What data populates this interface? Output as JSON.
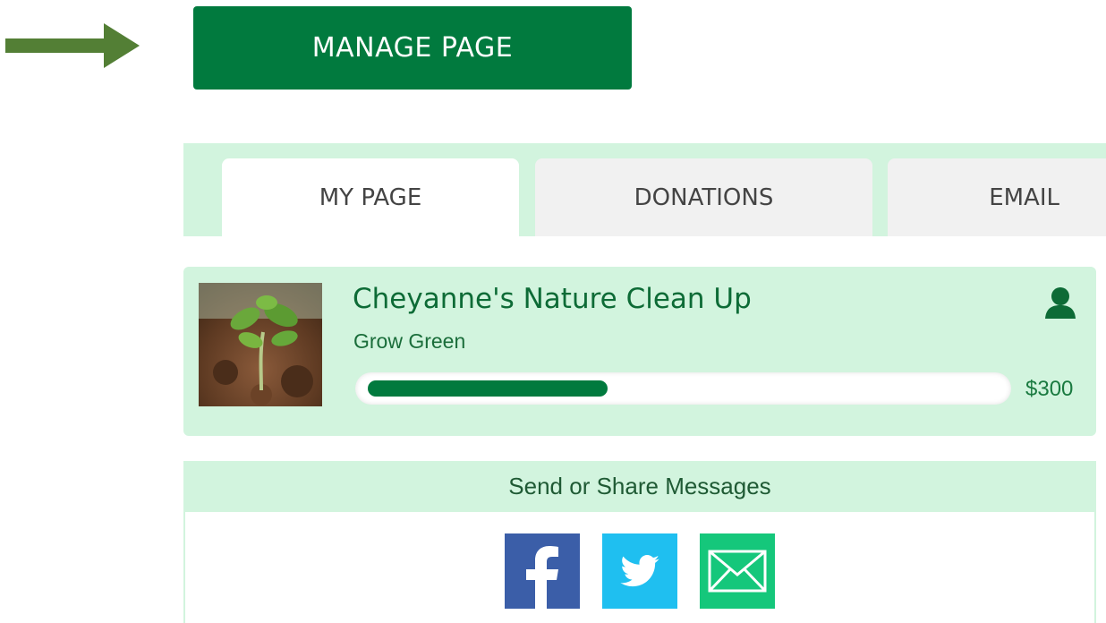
{
  "manage_button": {
    "label": "MANAGE PAGE"
  },
  "tabs": [
    {
      "label": "MY PAGE"
    },
    {
      "label": "DONATIONS"
    },
    {
      "label": "EMAIL"
    }
  ],
  "page_card": {
    "title": "Cheyanne's Nature Clean Up",
    "team": "Grow Green",
    "progress_fraction": 0.38,
    "goal": "$300",
    "image_icon": "seedling-photo",
    "user_icon": "user-icon"
  },
  "share": {
    "heading": "Send or Share Messages",
    "buttons": [
      {
        "icon": "facebook-icon"
      },
      {
        "icon": "twitter-icon"
      },
      {
        "icon": "email-icon"
      }
    ]
  },
  "colors": {
    "brand_green": "#017a3e",
    "light_green": "#d2f4de",
    "arrow_green": "#537f35",
    "facebook": "#3b5ea8",
    "twitter": "#1fbff0",
    "email": "#15c77b"
  }
}
